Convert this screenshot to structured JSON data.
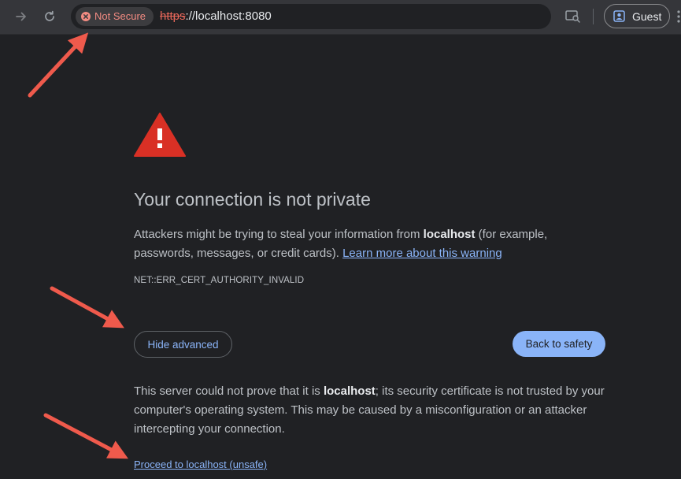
{
  "browser": {
    "security_chip_label": "Not Secure",
    "url_scheme": "https",
    "url_rest": "://localhost:8080",
    "profile_label": "Guest",
    "icons": [
      "forward-arrow-icon",
      "reload-icon",
      "security-warning-icon",
      "page-info-icon",
      "profile-icon"
    ]
  },
  "interstitial": {
    "heading": "Your connection is not private",
    "message_part1": "Attackers might be trying to steal your information from ",
    "message_host": "localhost",
    "message_part2": " (for example, passwords, messages, or credit cards). ",
    "learn_more_link": "Learn more about this warning",
    "error_code": "NET::ERR_CERT_AUTHORITY_INVALID",
    "hide_advanced_label": "Hide advanced",
    "back_to_safety_label": "Back to safety",
    "details_part1": "This server could not prove that it is ",
    "details_host": "localhost",
    "details_part2": "; its security certificate is not trusted by your computer's operating system. This may be caused by a misconfiguration or an attacker intercepting your connection.",
    "proceed_link": "Proceed to localhost (unsafe)"
  },
  "colors": {
    "page_background": "#202124",
    "toolbar_background": "#35363a",
    "warning_red": "#d93025",
    "link_blue": "#8ab4f8",
    "annotation_arrow": "#ef5a4c"
  }
}
